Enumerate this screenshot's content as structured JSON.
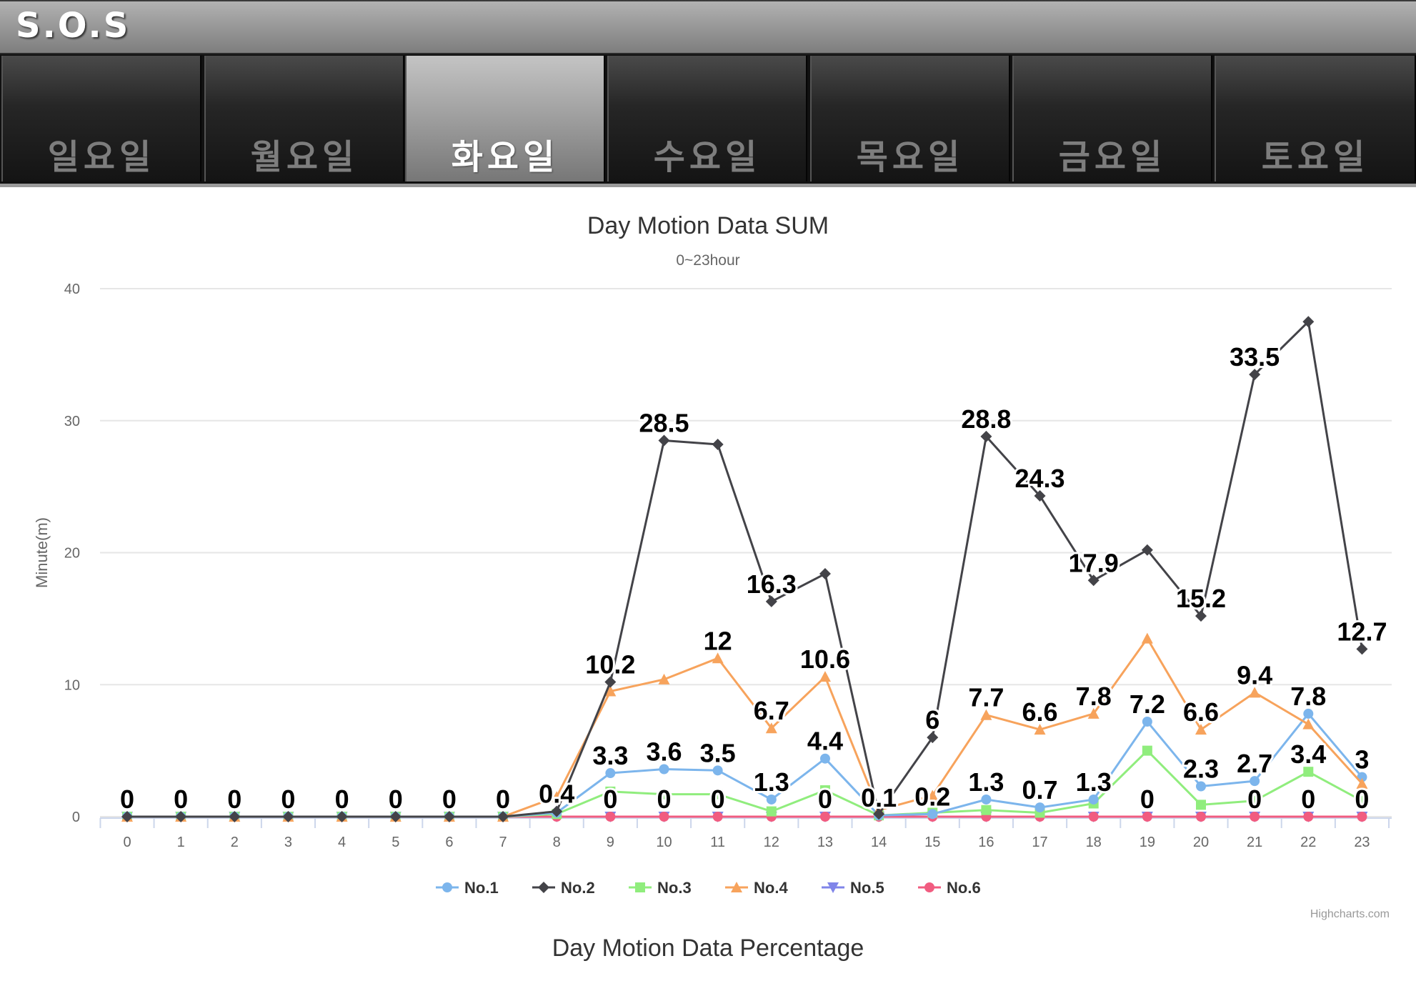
{
  "app": {
    "title": "S.O.S"
  },
  "tabs": [
    {
      "label": "일요일",
      "active": false
    },
    {
      "label": "월요일",
      "active": false
    },
    {
      "label": "화요일",
      "active": true
    },
    {
      "label": "수요일",
      "active": false
    },
    {
      "label": "목요일",
      "active": false
    },
    {
      "label": "금요일",
      "active": false
    },
    {
      "label": "토요일",
      "active": false
    }
  ],
  "chart_data": {
    "type": "line",
    "title": "Day Motion Data SUM",
    "subtitle": "0~23hour",
    "ylabel": "Minute(m)",
    "xlabel": "",
    "ylim": [
      0,
      40
    ],
    "yticks": [
      0,
      10,
      20,
      30,
      40
    ],
    "x": [
      0,
      1,
      2,
      3,
      4,
      5,
      6,
      7,
      8,
      9,
      10,
      11,
      12,
      13,
      14,
      15,
      16,
      17,
      18,
      19,
      20,
      21,
      22,
      23
    ],
    "grid": true,
    "legend_position": "bottom-center",
    "credits": "Highcharts.com",
    "series": [
      {
        "name": "No.1",
        "color": "#7cb5ec",
        "marker": "circle",
        "values": [
          0,
          0,
          0,
          0,
          0,
          0,
          0,
          0,
          0.3,
          3.3,
          3.6,
          3.5,
          1.3,
          4.4,
          0.1,
          0.2,
          1.3,
          0.7,
          1.3,
          7.2,
          2.3,
          2.7,
          7.8,
          3
        ]
      },
      {
        "name": "No.2",
        "color": "#434348",
        "marker": "diamond",
        "values": [
          0,
          0,
          0,
          0,
          0,
          0,
          0,
          0,
          0.4,
          10.2,
          28.5,
          28.2,
          16.3,
          18.4,
          0.2,
          6,
          28.8,
          24.3,
          17.9,
          20.2,
          15.2,
          33.5,
          37.5,
          12.7
        ]
      },
      {
        "name": "No.3",
        "color": "#90ed7d",
        "marker": "square",
        "values": [
          0,
          0,
          0,
          0,
          0,
          0,
          0,
          0,
          0.2,
          1.9,
          1.7,
          1.7,
          0.4,
          2.0,
          0.1,
          0.3,
          0.5,
          0.3,
          1.0,
          5.0,
          0.9,
          1.2,
          3.4,
          1.2
        ]
      },
      {
        "name": "No.4",
        "color": "#f7a35c",
        "marker": "triangle",
        "values": [
          0,
          0,
          0,
          0,
          0,
          0,
          0,
          0,
          1.5,
          9.5,
          10.4,
          12,
          6.7,
          10.6,
          0.5,
          1.6,
          7.7,
          6.6,
          7.8,
          13.5,
          6.6,
          9.4,
          7.0,
          2.5
        ]
      },
      {
        "name": "No.5",
        "color": "#8085e9",
        "marker": "triangle-down",
        "values": [
          0,
          0,
          0,
          0,
          0,
          0,
          0,
          0,
          0,
          0,
          0,
          0,
          0,
          0,
          0,
          0,
          0,
          0,
          0,
          0,
          0,
          0,
          0,
          0
        ]
      },
      {
        "name": "No.6",
        "color": "#f15c80",
        "marker": "circle",
        "values": [
          0,
          0,
          0,
          0,
          0,
          0,
          0,
          0,
          0,
          0,
          0,
          0,
          0,
          0,
          0,
          0,
          0,
          0,
          0,
          0,
          0,
          0,
          0,
          0
        ]
      }
    ],
    "data_labels": [
      {
        "x": 0,
        "y": 0,
        "text": "0"
      },
      {
        "x": 1,
        "y": 0,
        "text": "0"
      },
      {
        "x": 2,
        "y": 0,
        "text": "0"
      },
      {
        "x": 3,
        "y": 0,
        "text": "0"
      },
      {
        "x": 4,
        "y": 0,
        "text": "0"
      },
      {
        "x": 5,
        "y": 0,
        "text": "0"
      },
      {
        "x": 6,
        "y": 0,
        "text": "0"
      },
      {
        "x": 7,
        "y": 0,
        "text": "0"
      },
      {
        "x": 8,
        "y": 0.4,
        "text": "0.4"
      },
      {
        "x": 9,
        "y": 10.2,
        "text": "10.2"
      },
      {
        "x": 9,
        "y": 3.3,
        "text": "3.3"
      },
      {
        "x": 9,
        "y": 0,
        "text": "0"
      },
      {
        "x": 10,
        "y": 28.5,
        "text": "28.5"
      },
      {
        "x": 10,
        "y": 3.6,
        "text": "3.6"
      },
      {
        "x": 10,
        "y": 0,
        "text": "0"
      },
      {
        "x": 11,
        "y": 12,
        "text": "12"
      },
      {
        "x": 11,
        "y": 3.5,
        "text": "3.5"
      },
      {
        "x": 11,
        "y": 0,
        "text": "0"
      },
      {
        "x": 12,
        "y": 16.3,
        "text": "16.3"
      },
      {
        "x": 12,
        "y": 6.7,
        "text": "6.7"
      },
      {
        "x": 12,
        "y": 1.3,
        "text": "1.3"
      },
      {
        "x": 13,
        "y": 10.6,
        "text": "10.6"
      },
      {
        "x": 13,
        "y": 4.4,
        "text": "4.4"
      },
      {
        "x": 13,
        "y": 0,
        "text": "0"
      },
      {
        "x": 14,
        "y": 0.1,
        "text": "0.1"
      },
      {
        "x": 15,
        "y": 6,
        "text": "6"
      },
      {
        "x": 15,
        "y": 0.2,
        "text": "0.2"
      },
      {
        "x": 16,
        "y": 28.8,
        "text": "28.8"
      },
      {
        "x": 16,
        "y": 7.7,
        "text": "7.7"
      },
      {
        "x": 16,
        "y": 1.3,
        "text": "1.3"
      },
      {
        "x": 17,
        "y": 24.3,
        "text": "24.3"
      },
      {
        "x": 17,
        "y": 6.6,
        "text": "6.6"
      },
      {
        "x": 17,
        "y": 0.7,
        "text": "0.7"
      },
      {
        "x": 18,
        "y": 17.9,
        "text": "17.9"
      },
      {
        "x": 18,
        "y": 7.8,
        "text": "7.8"
      },
      {
        "x": 18,
        "y": 1.3,
        "text": "1.3"
      },
      {
        "x": 19,
        "y": 7.2,
        "text": "7.2"
      },
      {
        "x": 19,
        "y": 0,
        "text": "0"
      },
      {
        "x": 20,
        "y": 15.2,
        "text": "15.2"
      },
      {
        "x": 20,
        "y": 6.6,
        "text": "6.6"
      },
      {
        "x": 20,
        "y": 2.3,
        "text": "2.3"
      },
      {
        "x": 21,
        "y": 33.5,
        "text": "33.5"
      },
      {
        "x": 21,
        "y": 9.4,
        "text": "9.4"
      },
      {
        "x": 21,
        "y": 2.7,
        "text": "2.7"
      },
      {
        "x": 21,
        "y": 0,
        "text": "0"
      },
      {
        "x": 22,
        "y": 7.8,
        "text": "7.8"
      },
      {
        "x": 22,
        "y": 3.4,
        "text": "3.4"
      },
      {
        "x": 22,
        "y": 0,
        "text": "0"
      },
      {
        "x": 23,
        "y": 12.7,
        "text": "12.7"
      },
      {
        "x": 23,
        "y": 3,
        "text": "3"
      },
      {
        "x": 23,
        "y": 0,
        "text": "0"
      }
    ]
  },
  "percentage_section": {
    "title": "Day Motion Data Percentage"
  }
}
